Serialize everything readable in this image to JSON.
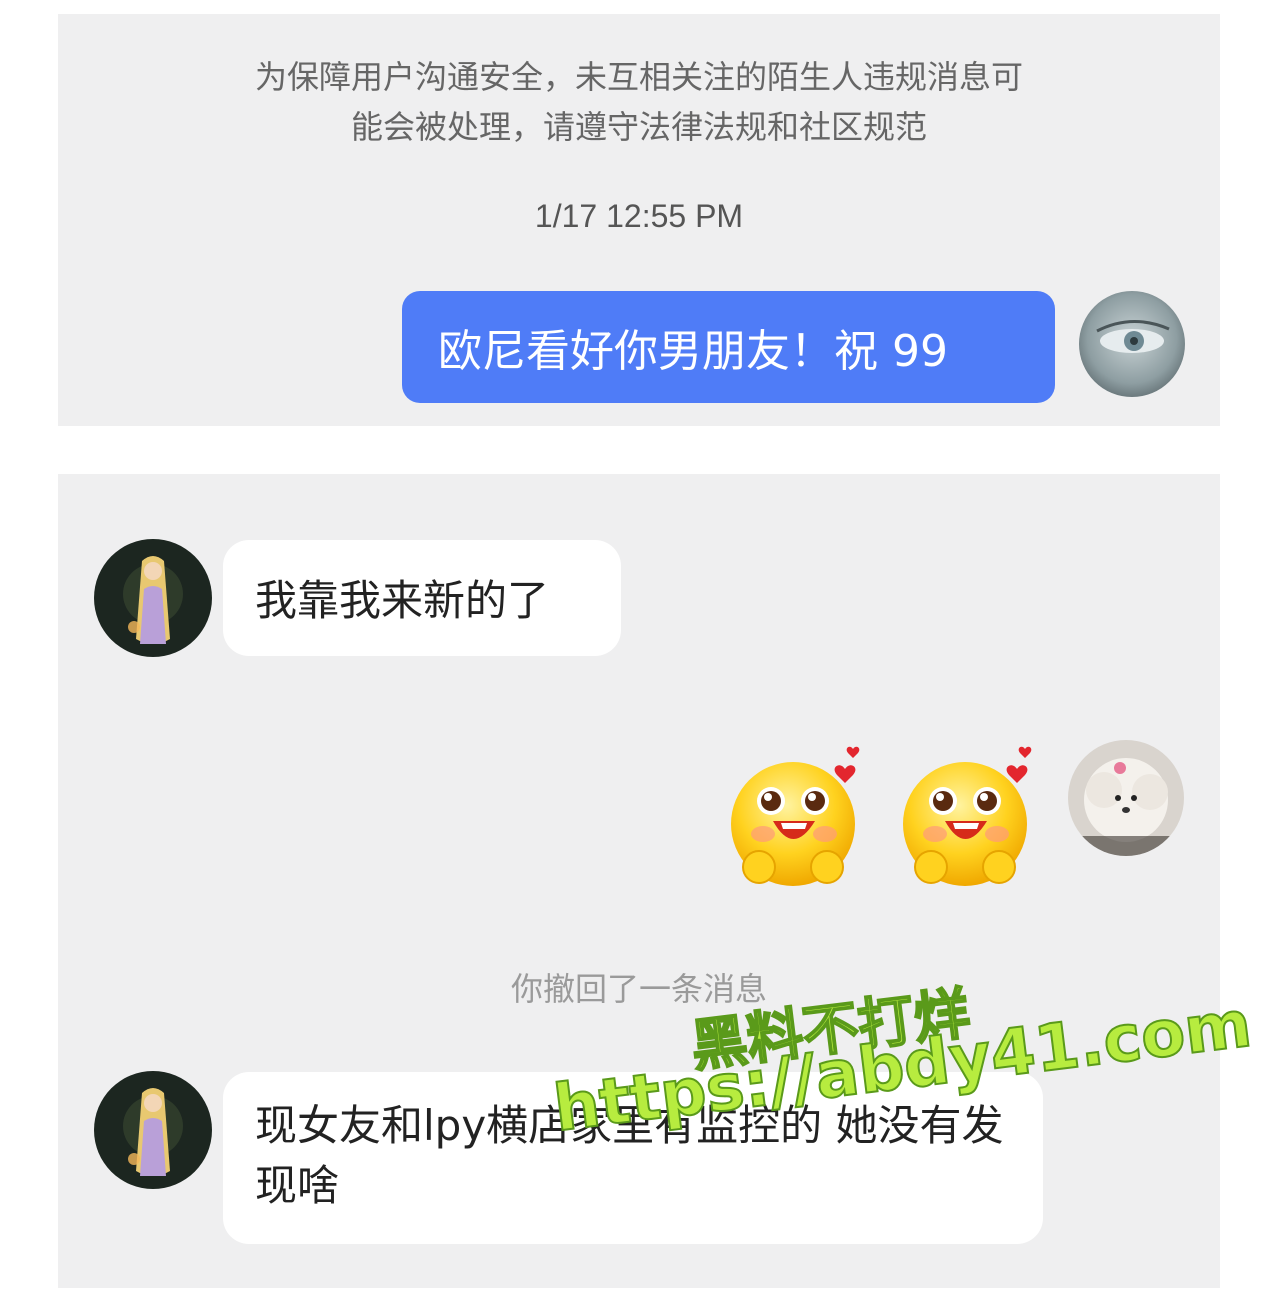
{
  "notice": {
    "line1": "为保障用户沟通安全，未互相关注的陌生人违规消息可",
    "line2": "能会被处理，请遵守法律法规和社区规范"
  },
  "timestamp": "1/17 12:55 PM",
  "messages": {
    "outgoing_1": "欧尼看好你男朋友！祝 99",
    "incoming_1": "我靠我来新的了",
    "recall_notice": "你撤回了一条消息",
    "incoming_2": "现女友和lpy横店家里有监控的 她没有发现啥"
  },
  "stickers": [
    "blush-smile-emoji",
    "blush-smile-emoji"
  ],
  "watermark": {
    "title": "黑料不打烊",
    "url": "https://abdy41.com"
  },
  "colors": {
    "outgoing_bubble": "#4f7cf7",
    "panel_bg": "#efeff0",
    "watermark": "#b7ec3f"
  }
}
